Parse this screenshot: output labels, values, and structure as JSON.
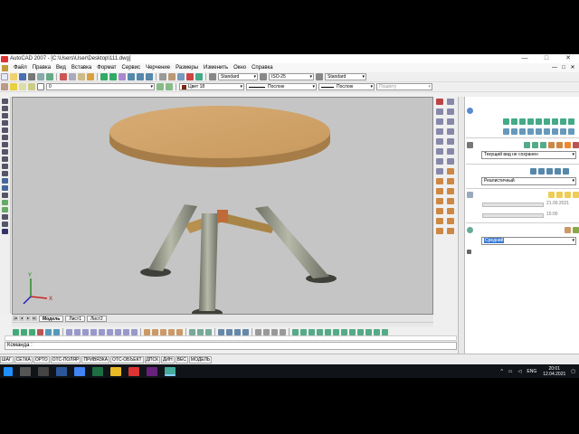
{
  "window": {
    "title": "AutoCAD 2007 - [C:\\Users\\User\\Desktop\\111.dwg]",
    "controls": [
      "—",
      "□",
      "✕"
    ]
  },
  "menu": {
    "items": [
      "Файл",
      "Правка",
      "Вид",
      "Вставка",
      "Формат",
      "Сервис",
      "Черчение",
      "Размеры",
      "Изменить",
      "Окно",
      "Справка"
    ],
    "doc_controls": [
      "—",
      "□",
      "✕"
    ]
  },
  "toolbar": {
    "text_style": "Standard",
    "dim_style": "ISO-25",
    "table_style": "Standard",
    "layer": "0",
    "color": "Цвет 18",
    "linetype": "Послою",
    "lineweight": "Послою",
    "plotstyle": "Поцвету"
  },
  "layout_tabs": [
    "Модель",
    "Лист1",
    "Лист2"
  ],
  "ucs": {
    "x": "X",
    "y": "Y"
  },
  "command": {
    "prompt": "Команда :"
  },
  "status": {
    "toggles": [
      "ШАГ",
      "СЕТКА",
      "ОРТО",
      "ОТС-ПОЛЯР",
      "ПРИВЯЗКА",
      "ОТС-ОБЪЕКТ",
      "ДПСК",
      "ДИН",
      "ВЕС",
      "МОДЕЛЬ"
    ]
  },
  "dashboard": {
    "view": "Текущий вид не сохранен",
    "visual_style": "Реалистичный",
    "date": "21.09.2021",
    "time": "15:00",
    "material": "Средний"
  },
  "taskbar": {
    "lang": "ENG",
    "time": "20:01",
    "date": "12.04.2021"
  },
  "colors": {
    "viewport_bg": "#c5c5c5",
    "tabletop": "#d9a86a",
    "legs": "#9b9d8c"
  }
}
